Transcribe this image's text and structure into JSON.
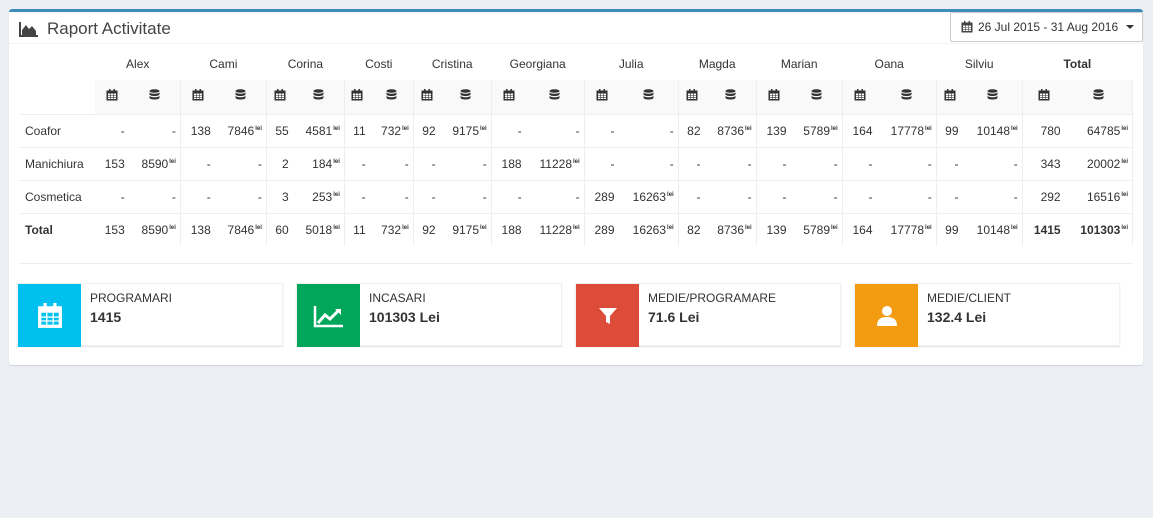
{
  "header": {
    "title": "Raport Activitate",
    "date_range": "26 Jul 2015 - 31 Aug 2016"
  },
  "table": {
    "currency_suffix": "lei",
    "columns": [
      "Alex",
      "Cami",
      "Corina",
      "Costi",
      "Cristina",
      "Georgiana",
      "Julia",
      "Magda",
      "Marian",
      "Oana",
      "Silviu",
      "Total"
    ],
    "rows": [
      {
        "label": "Coafor",
        "cells": [
          [
            "-",
            "-"
          ],
          [
            "138",
            "7846"
          ],
          [
            "55",
            "4581"
          ],
          [
            "11",
            "732"
          ],
          [
            "92",
            "9175"
          ],
          [
            "-",
            "-"
          ],
          [
            "-",
            "-"
          ],
          [
            "82",
            "8736"
          ],
          [
            "139",
            "5789"
          ],
          [
            "164",
            "17778"
          ],
          [
            "99",
            "10148"
          ],
          [
            "780",
            "64785"
          ]
        ]
      },
      {
        "label": "Manichiura",
        "cells": [
          [
            "153",
            "8590"
          ],
          [
            "-",
            "-"
          ],
          [
            "2",
            "184"
          ],
          [
            "-",
            "-"
          ],
          [
            "-",
            "-"
          ],
          [
            "188",
            "11228"
          ],
          [
            "-",
            "-"
          ],
          [
            "-",
            "-"
          ],
          [
            "-",
            "-"
          ],
          [
            "-",
            "-"
          ],
          [
            "-",
            "-"
          ],
          [
            "343",
            "20002"
          ]
        ]
      },
      {
        "label": "Cosmetica",
        "cells": [
          [
            "-",
            "-"
          ],
          [
            "-",
            "-"
          ],
          [
            "3",
            "253"
          ],
          [
            "-",
            "-"
          ],
          [
            "-",
            "-"
          ],
          [
            "-",
            "-"
          ],
          [
            "289",
            "16263"
          ],
          [
            "-",
            "-"
          ],
          [
            "-",
            "-"
          ],
          [
            "-",
            "-"
          ],
          [
            "-",
            "-"
          ],
          [
            "292",
            "16516"
          ]
        ]
      },
      {
        "label": "Total",
        "cells": [
          [
            "153",
            "8590"
          ],
          [
            "138",
            "7846"
          ],
          [
            "60",
            "5018"
          ],
          [
            "11",
            "732"
          ],
          [
            "92",
            "9175"
          ],
          [
            "188",
            "11228"
          ],
          [
            "289",
            "16263"
          ],
          [
            "82",
            "8736"
          ],
          [
            "139",
            "5789"
          ],
          [
            "164",
            "17778"
          ],
          [
            "99",
            "10148"
          ],
          [
            "1415",
            "101303"
          ]
        ]
      }
    ]
  },
  "info_boxes": [
    {
      "label": "PROGRAMARI",
      "value": "1415",
      "color": "#00c0ef",
      "icon": "calendar-icon"
    },
    {
      "label": "INCASARI",
      "value": "101303 Lei",
      "color": "#00a65a",
      "icon": "line-chart-icon"
    },
    {
      "label": "MEDIE/PROGRAMARE",
      "value": "71.6 Lei",
      "color": "#dd4b39",
      "icon": "filter-icon"
    },
    {
      "label": "MEDIE/CLIENT",
      "value": "132.4 Lei",
      "color": "#f39c12",
      "icon": "user-icon"
    }
  ]
}
